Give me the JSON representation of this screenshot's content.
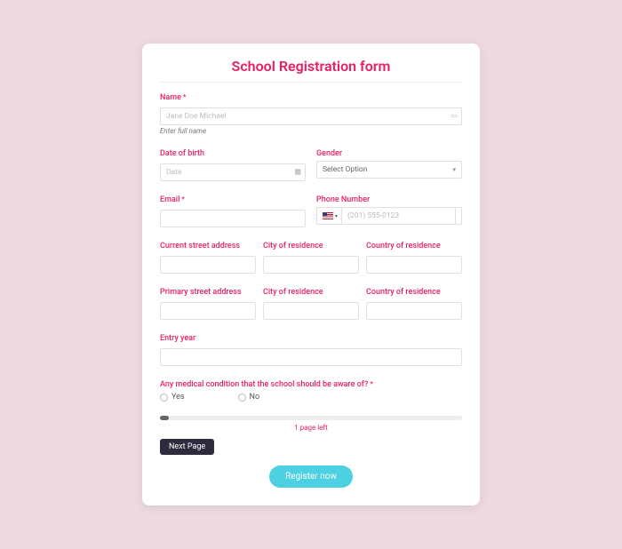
{
  "title": "School Registration form",
  "name": {
    "label": "Name",
    "placeholder": "Jane Doe Michael",
    "helper": "Enter full name"
  },
  "dob": {
    "label": "Date of birth",
    "placeholder": "Date"
  },
  "gender": {
    "label": "Gender",
    "selected": "Select Option"
  },
  "email": {
    "label": "Email"
  },
  "phone": {
    "label": "Phone Number",
    "placeholder": "(201) 555-0123"
  },
  "curr": {
    "street": "Current street address",
    "city": "City of residence",
    "country": "Country of residence"
  },
  "prim": {
    "street": "Primary street address",
    "city": "City of residence",
    "country": "Country of residence"
  },
  "entry": {
    "label": "Entry year"
  },
  "medical": {
    "label": "Any medical condition that the school should be aware of?",
    "yes": "Yes",
    "no": "No"
  },
  "pages_left": "1 page left",
  "next": "Next Page",
  "register": "Register now"
}
